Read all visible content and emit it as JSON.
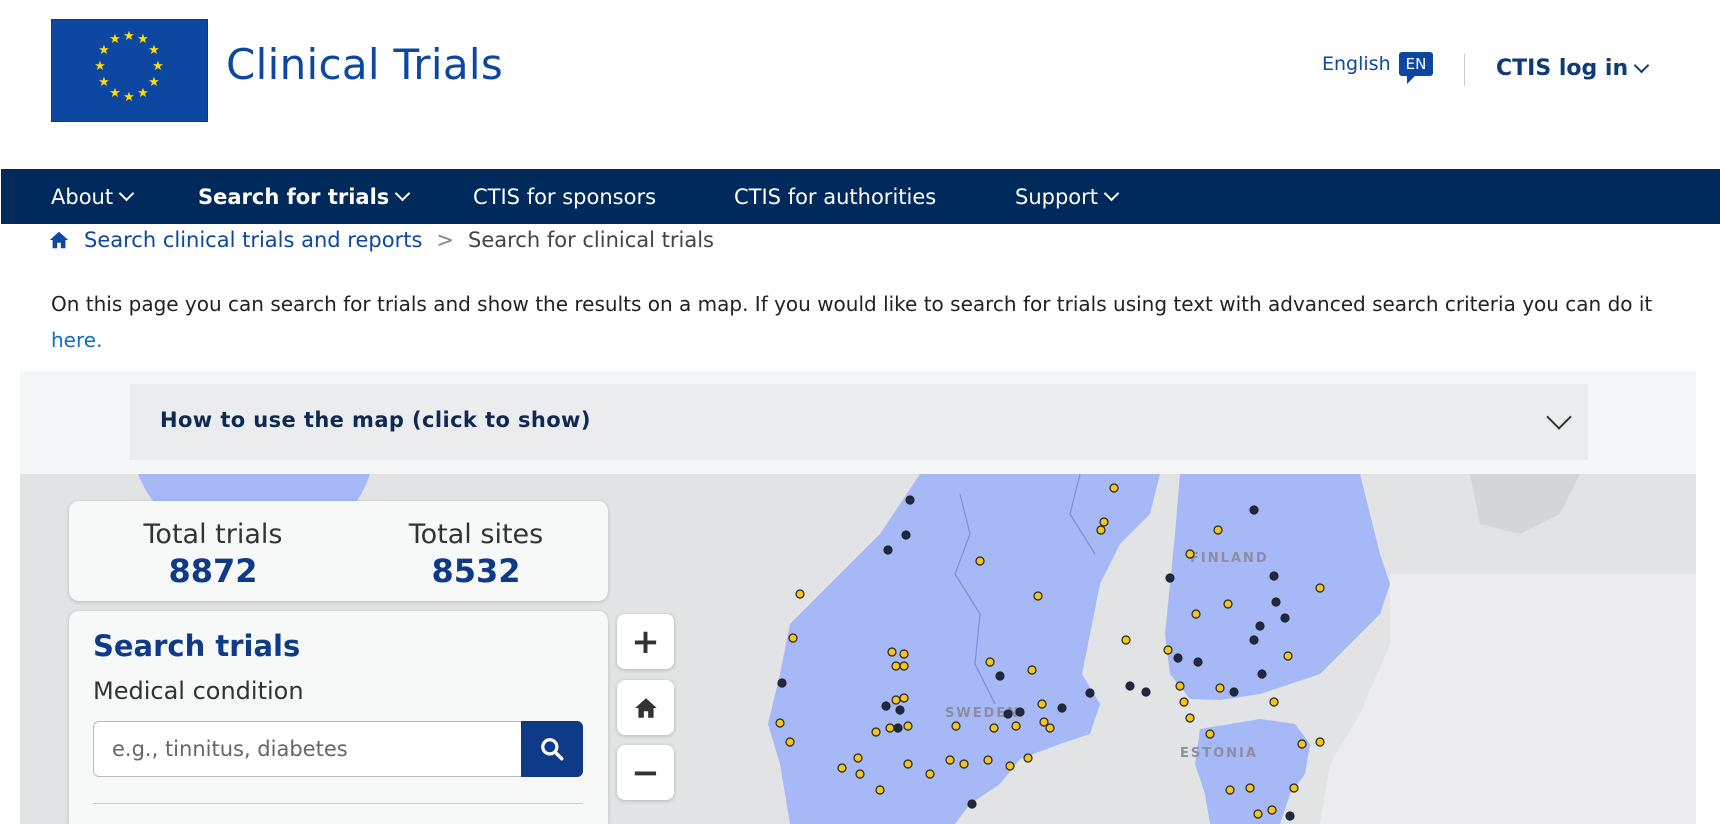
{
  "header": {
    "site_title": "Clinical Trials",
    "language_label": "English",
    "language_code": "EN",
    "login_label": "CTIS log in"
  },
  "nav": {
    "items": [
      {
        "label": "About"
      },
      {
        "label": "Search for trials"
      },
      {
        "label": "CTIS for sponsors"
      },
      {
        "label": "CTIS for authorities"
      },
      {
        "label": "Support"
      }
    ]
  },
  "breadcrumb": {
    "link": "Search clinical trials and reports",
    "separator": ">",
    "current": "Search for clinical trials"
  },
  "intro": {
    "text": "On this page you can search for trials and show the results on a map. If you would like to search for trials using text with advanced search criteria you can do it ",
    "link": "here."
  },
  "howto": {
    "label": "How to use the map  (click to show)"
  },
  "totals": {
    "trials_label": "Total trials",
    "trials_value": "8872",
    "sites_label": "Total sites",
    "sites_value": "8532"
  },
  "search": {
    "title": "Search trials",
    "condition_label": "Medical condition",
    "placeholder": "e.g., tinnitus, diabetes"
  },
  "map": {
    "labels": [
      "SWEDEN",
      "FINLAND",
      "ESTONIA"
    ],
    "controls": [
      "+",
      "−"
    ]
  },
  "colors": {
    "brand": "#0e47a1",
    "nav": "#002a5c",
    "land": "#a6b8f6",
    "marker_yellow": "#f5c518",
    "marker_dark": "#1b2a4a"
  },
  "icons": {
    "breadcrumb_home": "home-icon",
    "search": "search-icon",
    "map_home": "home-icon"
  }
}
